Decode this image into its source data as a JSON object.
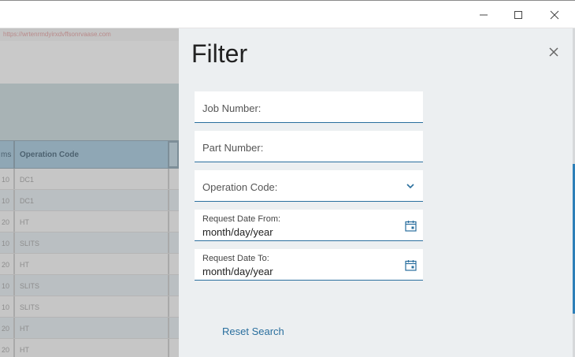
{
  "window": {
    "controls": {
      "minimize_icon": "minimize-icon",
      "maximize_icon": "maximize-icon",
      "close_icon": "close-icon"
    }
  },
  "background": {
    "url_text": "https://wrtenrmdyirxdvffsonrvaase.com",
    "table": {
      "header": {
        "col1": "ms",
        "col2": "Operation Code"
      },
      "rows": [
        {
          "col1": "10",
          "col2": "DC1"
        },
        {
          "col1": "10",
          "col2": "DC1"
        },
        {
          "col1": "20",
          "col2": "HT"
        },
        {
          "col1": "10",
          "col2": "SLITS"
        },
        {
          "col1": "20",
          "col2": "HT"
        },
        {
          "col1": "10",
          "col2": "SLITS"
        },
        {
          "col1": "10",
          "col2": "SLITS"
        },
        {
          "col1": "20",
          "col2": "HT"
        },
        {
          "col1": "20",
          "col2": "HT"
        }
      ]
    }
  },
  "filter": {
    "title": "Filter",
    "close_icon": "close-icon",
    "fields": {
      "job_number": {
        "label": "Job Number:"
      },
      "part_number": {
        "label": "Part Number:"
      },
      "operation_code": {
        "label": "Operation Code:",
        "icon": "chevron-down-icon"
      },
      "request_date_from": {
        "label": "Request Date From:",
        "value": "month/day/year",
        "icon": "calendar-icon"
      },
      "request_date_to": {
        "label": "Request Date To:",
        "value": "month/day/year",
        "icon": "calendar-icon"
      }
    },
    "reset_label": "Reset Search"
  },
  "colors": {
    "accent": "#2a6f9e",
    "panel_background": "#eceff1",
    "overlay_background": "#c4c4c4"
  }
}
